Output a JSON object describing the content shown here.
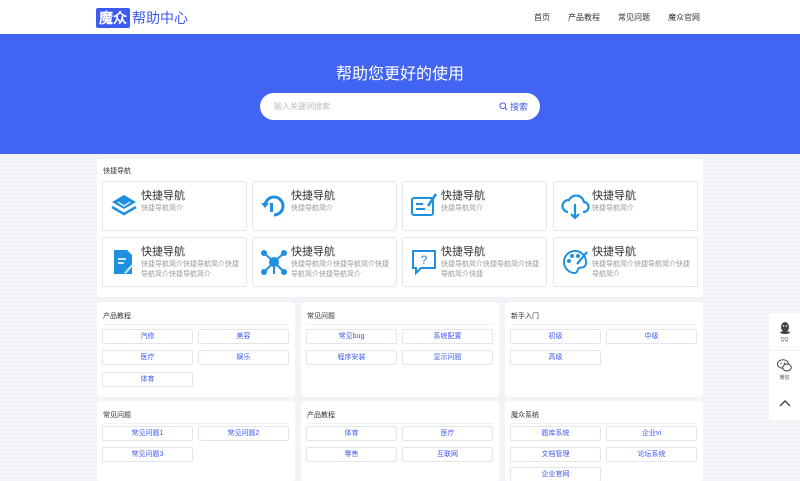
{
  "nav": {
    "logo_box": "魔众",
    "logo_text": "帮助中心",
    "menu": [
      "首页",
      "产品教程",
      "常见问题",
      "魔众官网"
    ]
  },
  "hero": {
    "title": "帮助您更好的使用",
    "search_placeholder": "输入关键词搜索",
    "search_button": "搜索"
  },
  "quick": {
    "title": "快捷导航",
    "cards": [
      {
        "title": "快捷导航",
        "desc": "快捷导航简介",
        "icon": "layers-icon"
      },
      {
        "title": "快捷导航",
        "desc": "快捷导航简介",
        "icon": "refresh-icon"
      },
      {
        "title": "快捷导航",
        "desc": "快捷导航简介",
        "icon": "edit-form-icon"
      },
      {
        "title": "快捷导航",
        "desc": "快捷导航简介",
        "icon": "cloud-download-icon"
      },
      {
        "title": "快捷导航",
        "desc": "快捷导航简介快捷导航简介快捷导航简介快捷导航简介",
        "icon": "document-edit-icon"
      },
      {
        "title": "快捷导航",
        "desc": "快捷导航简介快捷导航简介快捷导航简介快捷导航简介",
        "icon": "network-icon"
      },
      {
        "title": "快捷导航",
        "desc": "快捷导航简介快捷导航简介快捷导航简介快捷",
        "icon": "help-bubble-icon"
      },
      {
        "title": "快捷导航",
        "desc": "快捷导航简介快捷导航简介快捷导航简介",
        "icon": "palette-icon"
      }
    ]
  },
  "categories": [
    {
      "title": "产品教程",
      "tags": [
        "汽修",
        "美容",
        "医疗",
        "娱乐",
        "体育"
      ]
    },
    {
      "title": "常见问题",
      "tags": [
        "常见bug",
        "系统配置",
        "程序安装",
        "显示问题"
      ]
    },
    {
      "title": "新手入门",
      "tags": [
        "初级",
        "中级",
        "高级"
      ]
    },
    {
      "title": "常见问题",
      "tags": [
        "常见问题1",
        "常见问题2",
        "常见问题3"
      ]
    },
    {
      "title": "产品教程",
      "tags": [
        "体育",
        "医疗",
        "零售",
        "互联网"
      ]
    },
    {
      "title": "魔众系统",
      "tags": [
        "题库系统",
        "企业vi",
        "文档管理",
        "论坛系统",
        "企业官网"
      ]
    }
  ],
  "side": {
    "qq": "QQ",
    "wechat": "微信"
  },
  "colors": {
    "primary": "#3d5af1",
    "hero": "#4264f2"
  }
}
